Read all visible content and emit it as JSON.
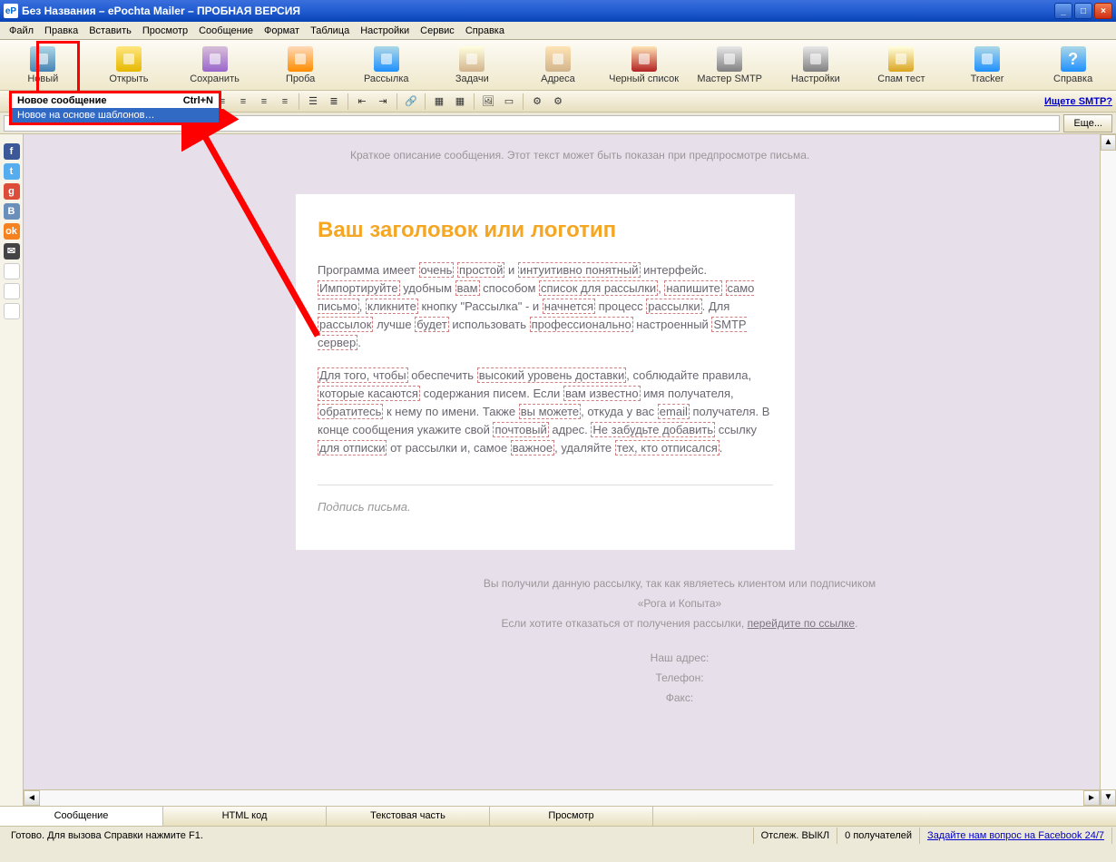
{
  "window": {
    "title": "Без Названия – ePochta Mailer – ПРОБНАЯ ВЕРСИЯ"
  },
  "menu": {
    "items": [
      "Файл",
      "Правка",
      "Вставить",
      "Просмотр",
      "Сообщение",
      "Формат",
      "Таблица",
      "Настройки",
      "Сервис",
      "Справка"
    ]
  },
  "toolbar": {
    "items": [
      {
        "id": "new",
        "label": "Новый",
        "icon": "i-new"
      },
      {
        "id": "open",
        "label": "Открыть",
        "icon": "i-open"
      },
      {
        "id": "save",
        "label": "Сохранить",
        "icon": "i-save"
      },
      {
        "id": "test",
        "label": "Проба",
        "icon": "i-test"
      },
      {
        "id": "send",
        "label": "Рассылка",
        "icon": "i-send"
      },
      {
        "id": "tasks",
        "label": "Задачи",
        "icon": "i-task"
      },
      {
        "id": "addresses",
        "label": "Адреса",
        "icon": "i-addr"
      },
      {
        "id": "blacklist",
        "label": "Черный список",
        "icon": "i-black"
      },
      {
        "id": "smtpwizard",
        "label": "Мастер SMTP",
        "icon": "i-smtp"
      },
      {
        "id": "settings",
        "label": "Настройки",
        "icon": "i-set"
      },
      {
        "id": "spamtest",
        "label": "Спам тест",
        "icon": "i-spam"
      },
      {
        "id": "tracker",
        "label": "Tracker",
        "icon": "i-track"
      },
      {
        "id": "help",
        "label": "Справка",
        "icon": "i-help"
      }
    ]
  },
  "dropdown": {
    "item1_label": "Новое сообщение",
    "item1_shortcut": "Ctrl+N",
    "item2_label": "Новое на основе шаблонов…"
  },
  "formatbar": {
    "link_smtp": "Ищете SMTP?"
  },
  "subbar": {
    "more_btn": "Еще..."
  },
  "editor": {
    "short_desc": "Краткое описание сообщения. Этот текст может быть показан при предпросмотре письма.",
    "heading": "Ваш заголовок или логотип",
    "p1_full": "Программа имеет очень простой и интуитивно понятный интерфейс. Импортируйте удобным вам способом список для рассылки, напишите само письмо, кликните кнопку \"Рассылка\" - и начнется процесс рассылки. Для рассылок лучше будет использовать профессионально настроенный SMTP сервер.",
    "p2_full": "Для того, чтобы обеспечить высокий уровень доставки, соблюдайте правила, которые касаются содержания писем. Если вам известно имя получателя, обратитесь к нему по имени. Также вы можете, откуда у вас email получателя. В конце сообщения укажите свой почтовый адрес. Не забудьте добавить ссылку для отписки от рассылки и, самое важное, удаляйте тех, кто отписался.",
    "signature": "Подпись письма.",
    "footer_line1": "Вы получили данную рассылку, так как являетесь клиентом или подписчиком",
    "footer_line2": "«Рога и Копыта»",
    "footer_unsub_pre": "Если хотите отказаться от получения рассылки, ",
    "footer_unsub_link": "перейдите по ссылке",
    "footer_addr": "Наш адрес:",
    "footer_phone": "Телефон:",
    "footer_fax": "Факс:"
  },
  "tabs": {
    "items": [
      "Сообщение",
      "HTML код",
      "Текстовая часть",
      "Просмотр"
    ]
  },
  "status": {
    "ready": "Готово. Для вызова Справки нажмите F1.",
    "track": "Отслеж. ВЫКЛ",
    "recipients": "0 получателей",
    "fb_link": "Задайте нам вопрос на Facebook 24/7"
  },
  "sidebar": {
    "icons": [
      {
        "name": "facebook-icon",
        "bg": "#3b5998",
        "txt": "f"
      },
      {
        "name": "twitter-icon",
        "bg": "#55acee",
        "txt": "t"
      },
      {
        "name": "google-plus-icon",
        "bg": "#dd4b39",
        "txt": "g"
      },
      {
        "name": "vk-icon",
        "bg": "#6a8fbb",
        "txt": "B"
      },
      {
        "name": "odnoklassniki-icon",
        "bg": "#f58220",
        "txt": "ok"
      },
      {
        "name": "mail-icon",
        "bg": "#444",
        "txt": "✉"
      },
      {
        "name": "code-icon",
        "bg": "#fff",
        "txt": ""
      },
      {
        "name": "google-icon",
        "bg": "#fff",
        "txt": ""
      },
      {
        "name": "smile-icon",
        "bg": "#fff",
        "txt": ""
      }
    ]
  }
}
